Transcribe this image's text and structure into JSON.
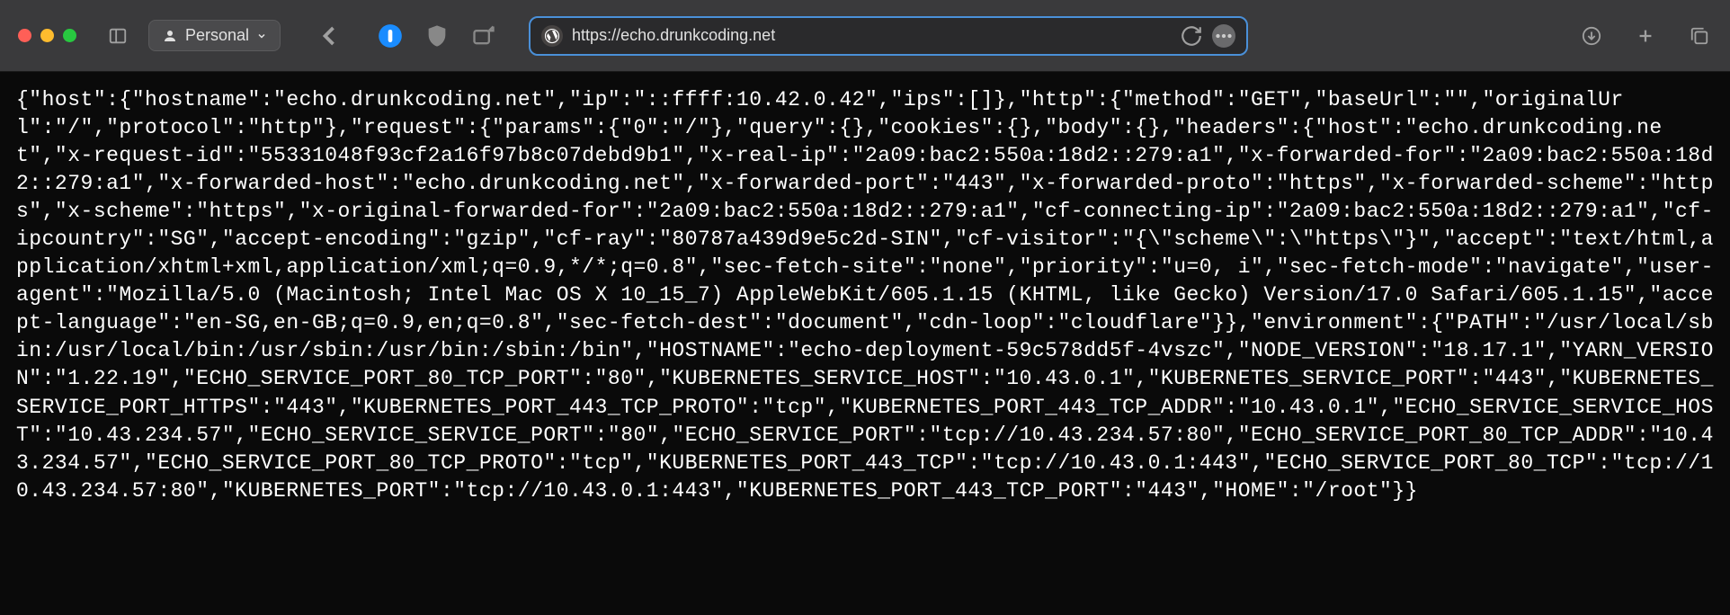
{
  "toolbar": {
    "profile_label": "Personal",
    "url": "https://echo.drunkcoding.net"
  },
  "response": {
    "host": {
      "hostname": "echo.drunkcoding.net",
      "ip": "::ffff:10.42.0.42",
      "ips": []
    },
    "http": {
      "method": "GET",
      "baseUrl": "",
      "originalUrl": "/",
      "protocol": "http"
    },
    "request": {
      "params": {
        "0": "/"
      },
      "query": {},
      "cookies": {},
      "body": {},
      "headers": {
        "host": "echo.drunkcoding.net",
        "x-request-id": "55331048f93cf2a16f97b8c07debd9b1",
        "x-real-ip": "2a09:bac2:550a:18d2::279:a1",
        "x-forwarded-for": "2a09:bac2:550a:18d2::279:a1",
        "x-forwarded-host": "echo.drunkcoding.net",
        "x-forwarded-port": "443",
        "x-forwarded-proto": "https",
        "x-forwarded-scheme": "https",
        "x-scheme": "https",
        "x-original-forwarded-for": "2a09:bac2:550a:18d2::279:a1",
        "cf-connecting-ip": "2a09:bac2:550a:18d2::279:a1",
        "cf-ipcountry": "SG",
        "accept-encoding": "gzip",
        "cf-ray": "80787a439d9e5c2d-SIN",
        "cf-visitor": "{\"scheme\":\"https\"}",
        "accept": "text/html,application/xhtml+xml,application/xml;q=0.9,*/*;q=0.8",
        "sec-fetch-site": "none",
        "priority": "u=0, i",
        "sec-fetch-mode": "navigate",
        "user-agent": "Mozilla/5.0 (Macintosh; Intel Mac OS X 10_15_7) AppleWebKit/605.1.15 (KHTML, like Gecko) Version/17.0 Safari/605.1.15",
        "accept-language": "en-SG,en-GB;q=0.9,en;q=0.8",
        "sec-fetch-dest": "document",
        "cdn-loop": "cloudflare"
      }
    },
    "environment": {
      "PATH": "/usr/local/sbin:/usr/local/bin:/usr/sbin:/usr/bin:/sbin:/bin",
      "HOSTNAME": "echo-deployment-59c578dd5f-4vszc",
      "NODE_VERSION": "18.17.1",
      "YARN_VERSION": "1.22.19",
      "ECHO_SERVICE_PORT_80_TCP_PORT": "80",
      "KUBERNETES_SERVICE_HOST": "10.43.0.1",
      "KUBERNETES_SERVICE_PORT": "443",
      "KUBERNETES_SERVICE_PORT_HTTPS": "443",
      "KUBERNETES_PORT_443_TCP_PROTO": "tcp",
      "KUBERNETES_PORT_443_TCP_ADDR": "10.43.0.1",
      "ECHO_SERVICE_SERVICE_HOST": "10.43.234.57",
      "ECHO_SERVICE_SERVICE_PORT": "80",
      "ECHO_SERVICE_PORT": "tcp://10.43.234.57:80",
      "ECHO_SERVICE_PORT_80_TCP_ADDR": "10.43.234.57",
      "ECHO_SERVICE_PORT_80_TCP_PROTO": "tcp",
      "KUBERNETES_PORT_443_TCP": "tcp://10.43.0.1:443",
      "ECHO_SERVICE_PORT_80_TCP": "tcp://10.43.234.57:80",
      "KUBERNETES_PORT": "tcp://10.43.0.1:443",
      "KUBERNETES_PORT_443_TCP_PORT": "443",
      "HOME": "/root"
    }
  },
  "response_text": "{\"host\":{\"hostname\":\"echo.drunkcoding.net\",\"ip\":\"::ffff:10.42.0.42\",\"ips\":[]},\"http\":{\"method\":\"GET\",\"baseUrl\":\"\",\"originalUrl\":\"/\",\"protocol\":\"http\"},\"request\":{\"params\":{\"0\":\"/\"},\"query\":{},\"cookies\":{},\"body\":{},\"headers\":{\"host\":\"echo.drunkcoding.net\",\"x-request-id\":\"55331048f93cf2a16f97b8c07debd9b1\",\"x-real-ip\":\"2a09:bac2:550a:18d2::279:a1\",\"x-forwarded-for\":\"2a09:bac2:550a:18d2::279:a1\",\"x-forwarded-host\":\"echo.drunkcoding.net\",\"x-forwarded-port\":\"443\",\"x-forwarded-proto\":\"https\",\"x-forwarded-scheme\":\"https\",\"x-scheme\":\"https\",\"x-original-forwarded-for\":\"2a09:bac2:550a:18d2::279:a1\",\"cf-connecting-ip\":\"2a09:bac2:550a:18d2::279:a1\",\"cf-ipcountry\":\"SG\",\"accept-encoding\":\"gzip\",\"cf-ray\":\"80787a439d9e5c2d-SIN\",\"cf-visitor\":\"{\\\"scheme\\\":\\\"https\\\"}\",\"accept\":\"text/html,application/xhtml+xml,application/xml;q=0.9,*/*;q=0.8\",\"sec-fetch-site\":\"none\",\"priority\":\"u=0, i\",\"sec-fetch-mode\":\"navigate\",\"user-agent\":\"Mozilla/5.0 (Macintosh; Intel Mac OS X 10_15_7) AppleWebKit/605.1.15 (KHTML, like Gecko) Version/17.0 Safari/605.1.15\",\"accept-language\":\"en-SG,en-GB;q=0.9,en;q=0.8\",\"sec-fetch-dest\":\"document\",\"cdn-loop\":\"cloudflare\"}},\"environment\":{\"PATH\":\"/usr/local/sbin:/usr/local/bin:/usr/sbin:/usr/bin:/sbin:/bin\",\"HOSTNAME\":\"echo-deployment-59c578dd5f-4vszc\",\"NODE_VERSION\":\"18.17.1\",\"YARN_VERSION\":\"1.22.19\",\"ECHO_SERVICE_PORT_80_TCP_PORT\":\"80\",\"KUBERNETES_SERVICE_HOST\":\"10.43.0.1\",\"KUBERNETES_SERVICE_PORT\":\"443\",\"KUBERNETES_SERVICE_PORT_HTTPS\":\"443\",\"KUBERNETES_PORT_443_TCP_PROTO\":\"tcp\",\"KUBERNETES_PORT_443_TCP_ADDR\":\"10.43.0.1\",\"ECHO_SERVICE_SERVICE_HOST\":\"10.43.234.57\",\"ECHO_SERVICE_SERVICE_PORT\":\"80\",\"ECHO_SERVICE_PORT\":\"tcp://10.43.234.57:80\",\"ECHO_SERVICE_PORT_80_TCP_ADDR\":\"10.43.234.57\",\"ECHO_SERVICE_PORT_80_TCP_PROTO\":\"tcp\",\"KUBERNETES_PORT_443_TCP\":\"tcp://10.43.0.1:443\",\"ECHO_SERVICE_PORT_80_TCP\":\"tcp://10.43.234.57:80\",\"KUBERNETES_PORT\":\"tcp://10.43.0.1:443\",\"KUBERNETES_PORT_443_TCP_PORT\":\"443\",\"HOME\":\"/root\"}}"
}
